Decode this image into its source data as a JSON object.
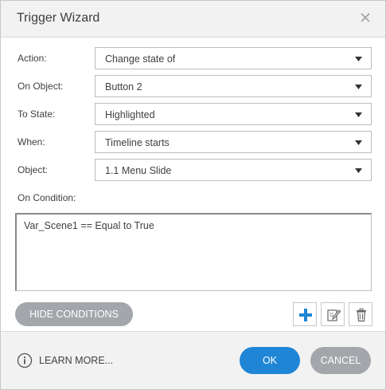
{
  "dialog": {
    "title": "Trigger Wizard"
  },
  "fields": {
    "action": {
      "label": "Action:",
      "value": "Change state of"
    },
    "on_object": {
      "label": "On Object:",
      "value": "Button 2"
    },
    "to_state": {
      "label": "To State:",
      "value": "Highlighted"
    },
    "when": {
      "label": "When:",
      "value": "Timeline starts"
    },
    "object": {
      "label": "Object:",
      "value": "1.1 Menu Slide"
    }
  },
  "conditions": {
    "label": "On Condition:",
    "items": [
      "Var_Scene1 == Equal to True"
    ]
  },
  "buttons": {
    "hide_conditions": "HIDE CONDITIONS",
    "learn_more": "LEARN MORE...",
    "ok": "OK",
    "cancel": "CANCEL"
  },
  "icons": {
    "close": "close-icon",
    "add": "plus-icon",
    "edit": "edit-icon",
    "delete": "trash-icon",
    "info": "info-icon",
    "dropdown": "chevron-down-icon"
  },
  "colors": {
    "primary": "#1f86d6",
    "secondary_button": "#a3a7ab",
    "add_icon": "#1f86d6"
  }
}
